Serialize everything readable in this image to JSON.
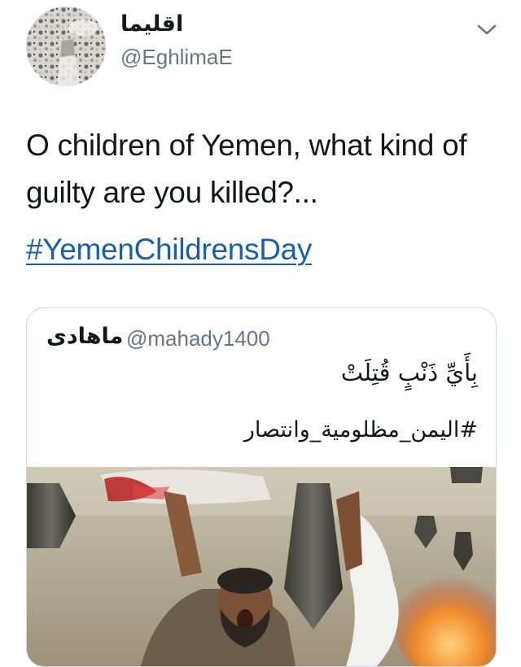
{
  "tweet": {
    "display_name": "اقليما",
    "handle": "@EghlimaE",
    "text": "O children of Yemen, what kind of guilty are you killed?...",
    "hashtag": "#YemenChildrensDay",
    "menu_icon": "chevron-down-icon"
  },
  "quoted_tweet": {
    "display_name": "ماهادى",
    "handle": "@mahady1400",
    "line1": "بِأَيِّ ذَنْبٍ قُتِلَتْ",
    "line2": "#اليمن_مظلومية_وانتصار",
    "media": "photo"
  },
  "colors": {
    "link": "#1b5fa8",
    "secondary_text": "#657786",
    "border": "#cfd9de"
  }
}
